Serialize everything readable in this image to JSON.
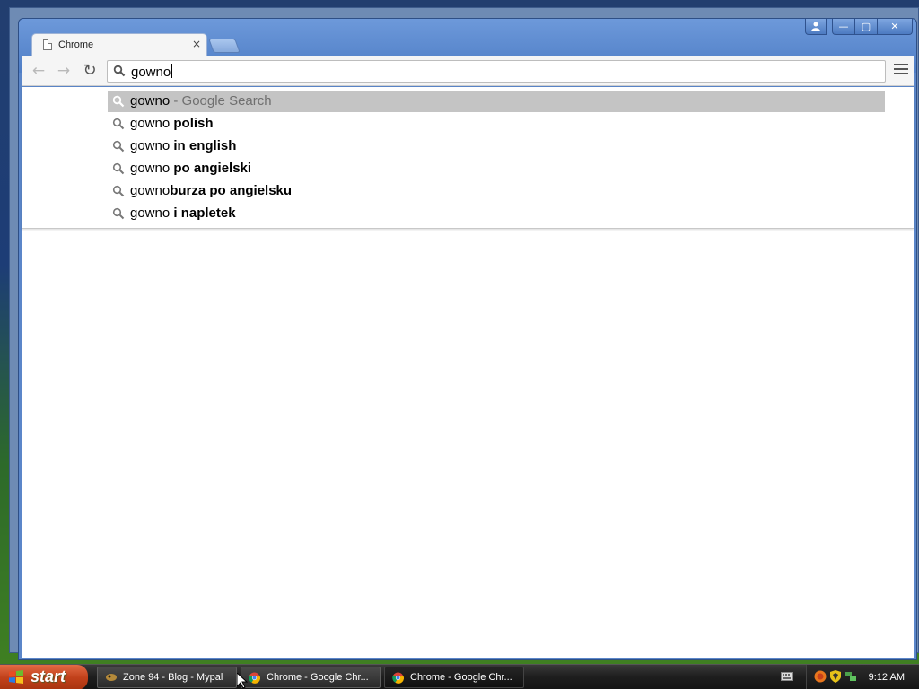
{
  "browser": {
    "tab_title": "Chrome",
    "tab_close": "×",
    "omnibox_value": "gowno",
    "back_glyph": "←",
    "forward_glyph": "→",
    "reload_glyph": "↻"
  },
  "window_controls": {
    "minimize": "—",
    "maximize": "▢",
    "close": "✕"
  },
  "suggestions": [
    {
      "typed": "gowno",
      "completion": "",
      "suffix": " - Google Search",
      "selected": true
    },
    {
      "typed": "gowno",
      "completion": " polish",
      "suffix": "",
      "selected": false
    },
    {
      "typed": "gowno",
      "completion": " in english",
      "suffix": "",
      "selected": false
    },
    {
      "typed": "gowno",
      "completion": " po angielski",
      "suffix": "",
      "selected": false
    },
    {
      "typed": "gowno",
      "completion": "burza po angielsku",
      "suffix": "",
      "selected": false
    },
    {
      "typed": "gowno",
      "completion": " i napletek",
      "suffix": "",
      "selected": false
    }
  ],
  "taskbar": {
    "start_label": "start",
    "tasks": [
      {
        "label": "Zone 94 - Blog - Mypal",
        "icon": "mypal-icon",
        "active": false
      },
      {
        "label": "Chrome - Google Chr...",
        "icon": "chrome-icon",
        "active": false
      },
      {
        "label": "Chrome - Google Chr...",
        "icon": "chrome-icon",
        "active": true
      }
    ],
    "clock": "9:12 AM"
  },
  "colors": {
    "selected_row": "#c4c4c4",
    "window_frame": "#5b86c9",
    "start_button": "#c2411b"
  }
}
